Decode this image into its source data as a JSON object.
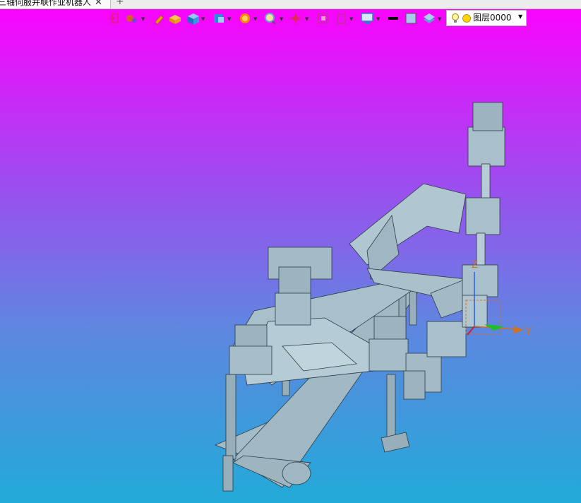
{
  "window": {
    "tab_title": "三轴伺服并联作业机器人",
    "tab_close": "✕",
    "new_tab": "+"
  },
  "toolbar": {
    "items": [
      {
        "name": "exit-sketch",
        "color": "#e0207a"
      },
      {
        "name": "snap-tools",
        "color": "#d06030"
      },
      {
        "name": "pencil",
        "color": "#e6a000"
      },
      {
        "name": "shade-box",
        "color": "#f0b020"
      },
      {
        "name": "view-cube",
        "color": "#2a8ed8"
      },
      {
        "name": "view-orient",
        "color": "#2a8ed8"
      },
      {
        "name": "render-style",
        "color": "#f28c00"
      },
      {
        "name": "zoom",
        "color": "#6a9fd8"
      },
      {
        "name": "move",
        "color": "#e02a50"
      },
      {
        "name": "section",
        "color": "#c03090"
      },
      {
        "name": "bounding-box",
        "color": "#c03090"
      },
      {
        "name": "display-settings",
        "color": "#2e7ec8"
      },
      {
        "name": "line-color",
        "color": "#000000"
      },
      {
        "name": "face-color",
        "color": "#a8c8f0"
      },
      {
        "name": "layer-manager",
        "color": "#5aa0d0"
      }
    ],
    "layer_select": {
      "value": "图层0000",
      "arrow": "▼"
    }
  },
  "viewport": {
    "background_top": "#ff00ff",
    "background_bottom": "#22aad8",
    "model_color": "#a9c3cf",
    "triad": {
      "y_label": "Y",
      "z_label": "Z",
      "x_color": "#d02020",
      "y_color": "#20c020",
      "z_color": "#2060e0",
      "label_color": "#d07020"
    }
  }
}
